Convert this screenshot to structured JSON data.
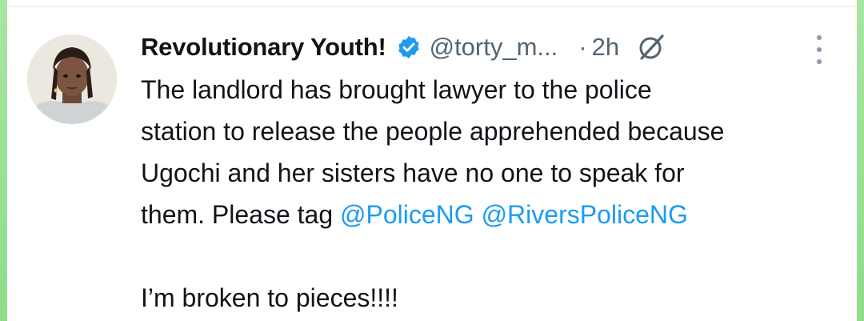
{
  "post": {
    "author": {
      "display_name": "Revolutionary Youth!",
      "handle": "@torty_m...",
      "verified": true,
      "avatar_icon": "avatar-photo"
    },
    "separator": "·",
    "time": "2h",
    "grok_icon": "grok-icon",
    "more_icon": "more-vertical-icon",
    "text": {
      "line1": "The landlord has brought lawyer to the police",
      "line2": "station to release the people apprehended because",
      "line3": "Ugochi and her sisters have no one to speak for",
      "line4_prefix": "them. Please tag ",
      "mention1": "@PoliceNG",
      "mention2": "@RiversPoliceNG",
      "line6": "I’m broken to pieces!!!!"
    }
  },
  "colors": {
    "text": "#0f1419",
    "secondary": "#536471",
    "link": "#1d9bf0",
    "verified": "#1d9bf0",
    "frame": "#8fdc8a"
  }
}
